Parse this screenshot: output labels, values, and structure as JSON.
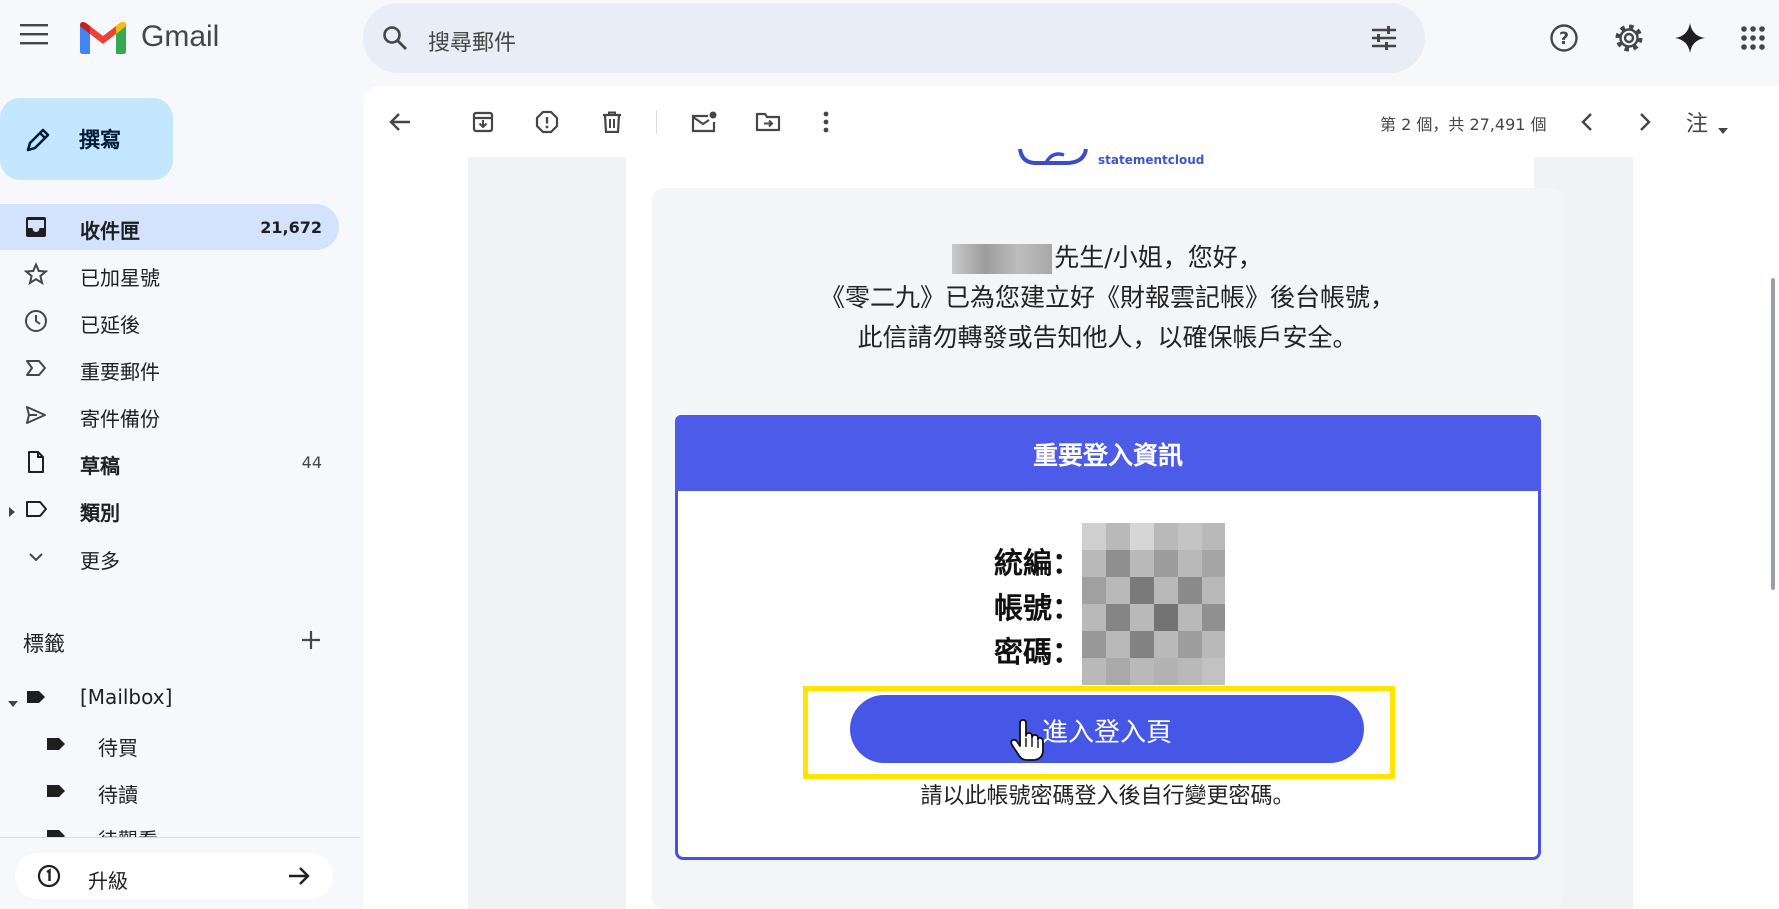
{
  "app": {
    "name": "Gmail"
  },
  "search": {
    "placeholder": "搜尋郵件"
  },
  "sidebar": {
    "compose_label": "撰寫",
    "items": [
      {
        "label": "收件匣",
        "count": "21,672"
      },
      {
        "label": "已加星號",
        "count": ""
      },
      {
        "label": "已延後",
        "count": ""
      },
      {
        "label": "重要郵件",
        "count": ""
      },
      {
        "label": "寄件備份",
        "count": ""
      },
      {
        "label": "草稿",
        "count": "44"
      },
      {
        "label": "類別",
        "count": ""
      },
      {
        "label": "更多",
        "count": ""
      }
    ],
    "labels_title": "標籤",
    "labels": [
      {
        "label": "[Mailbox]"
      },
      {
        "label": "待買"
      },
      {
        "label": "待讀"
      },
      {
        "label": "待觀看"
      }
    ],
    "upgrade_label": "升級"
  },
  "toolbar": {
    "pager": "第 2 個，共 27,491 個",
    "lang": "注"
  },
  "email": {
    "brand": "statementcloud",
    "greeting_suffix": "先生/小姐，您好，",
    "line2": "《零二九》已為您建立好《財報雲記帳》後台帳號，",
    "line3": "此信請勿轉發或告知他人，以確保帳戶安全。",
    "info_title": "重要登入資訊",
    "fields": [
      "統編：",
      "帳號：",
      "密碼："
    ],
    "login_button": "進入登入頁",
    "login_hint": "請以此帳號密碼登入後自行變更密碼。"
  },
  "colors": {
    "accent": "#4c5be8",
    "highlight": "#ffe500",
    "compose_bg": "#c2e7ff",
    "active_nav": "#d3e3fd"
  }
}
